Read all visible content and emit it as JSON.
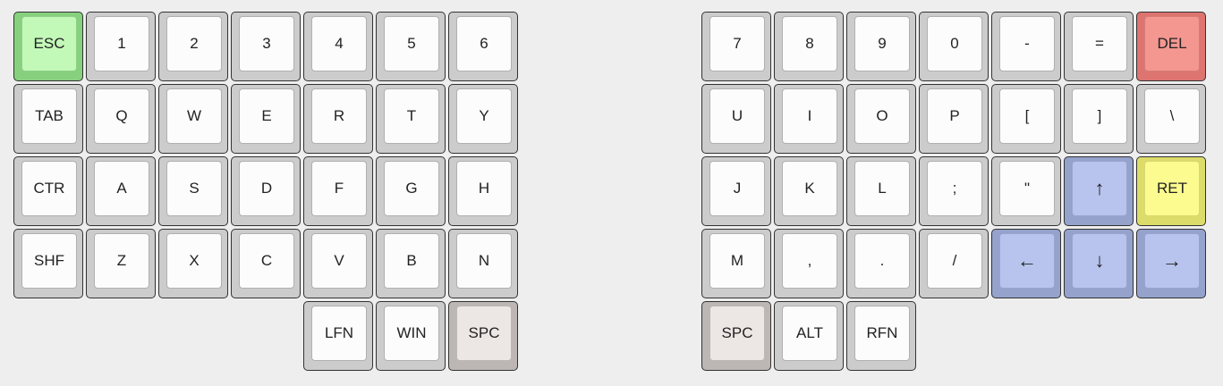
{
  "keyboard": {
    "left_half": {
      "rows": [
        [
          {
            "label": "ESC",
            "color": "#c3f9b8"
          },
          {
            "label": "1"
          },
          {
            "label": "2"
          },
          {
            "label": "3"
          },
          {
            "label": "4"
          },
          {
            "label": "5"
          },
          {
            "label": "6"
          }
        ],
        [
          {
            "label": "TAB"
          },
          {
            "label": "Q"
          },
          {
            "label": "W"
          },
          {
            "label": "E"
          },
          {
            "label": "R"
          },
          {
            "label": "T"
          },
          {
            "label": "Y"
          }
        ],
        [
          {
            "label": "CTR"
          },
          {
            "label": "A"
          },
          {
            "label": "S"
          },
          {
            "label": "D"
          },
          {
            "label": "F"
          },
          {
            "label": "G"
          },
          {
            "label": "H"
          }
        ],
        [
          {
            "label": "SHF"
          },
          {
            "label": "Z"
          },
          {
            "label": "X"
          },
          {
            "label": "C"
          },
          {
            "label": "V"
          },
          {
            "label": "B"
          },
          {
            "label": "N"
          }
        ],
        [
          {
            "label": "LFN"
          },
          {
            "label": "WIN"
          },
          {
            "label": "SPC",
            "color": "#ece6e4"
          }
        ]
      ]
    },
    "right_half": {
      "rows": [
        [
          {
            "label": "7"
          },
          {
            "label": "8"
          },
          {
            "label": "9"
          },
          {
            "label": "0"
          },
          {
            "label": "-"
          },
          {
            "label": "="
          },
          {
            "label": "DEL",
            "color": "#f39790"
          }
        ],
        [
          {
            "label": "U"
          },
          {
            "label": "I"
          },
          {
            "label": "O"
          },
          {
            "label": "P"
          },
          {
            "label": "["
          },
          {
            "label": "]"
          },
          {
            "label": "\\"
          }
        ],
        [
          {
            "label": "J"
          },
          {
            "label": "K"
          },
          {
            "label": "L"
          },
          {
            "label": ";"
          },
          {
            "label": "\""
          },
          {
            "label": "↑",
            "color": "#b8c4ee"
          },
          {
            "label": "RET",
            "color": "#fbfb8f"
          }
        ],
        [
          {
            "label": "M"
          },
          {
            "label": ","
          },
          {
            "label": "."
          },
          {
            "label": "/"
          },
          {
            "label": "←",
            "color": "#b8c4ee"
          },
          {
            "label": "↓",
            "color": "#b8c4ee"
          },
          {
            "label": "→",
            "color": "#b8c4ee"
          }
        ],
        [
          {
            "label": "SPC",
            "color": "#ece6e4"
          },
          {
            "label": "ALT"
          },
          {
            "label": "RFN"
          }
        ]
      ]
    }
  }
}
